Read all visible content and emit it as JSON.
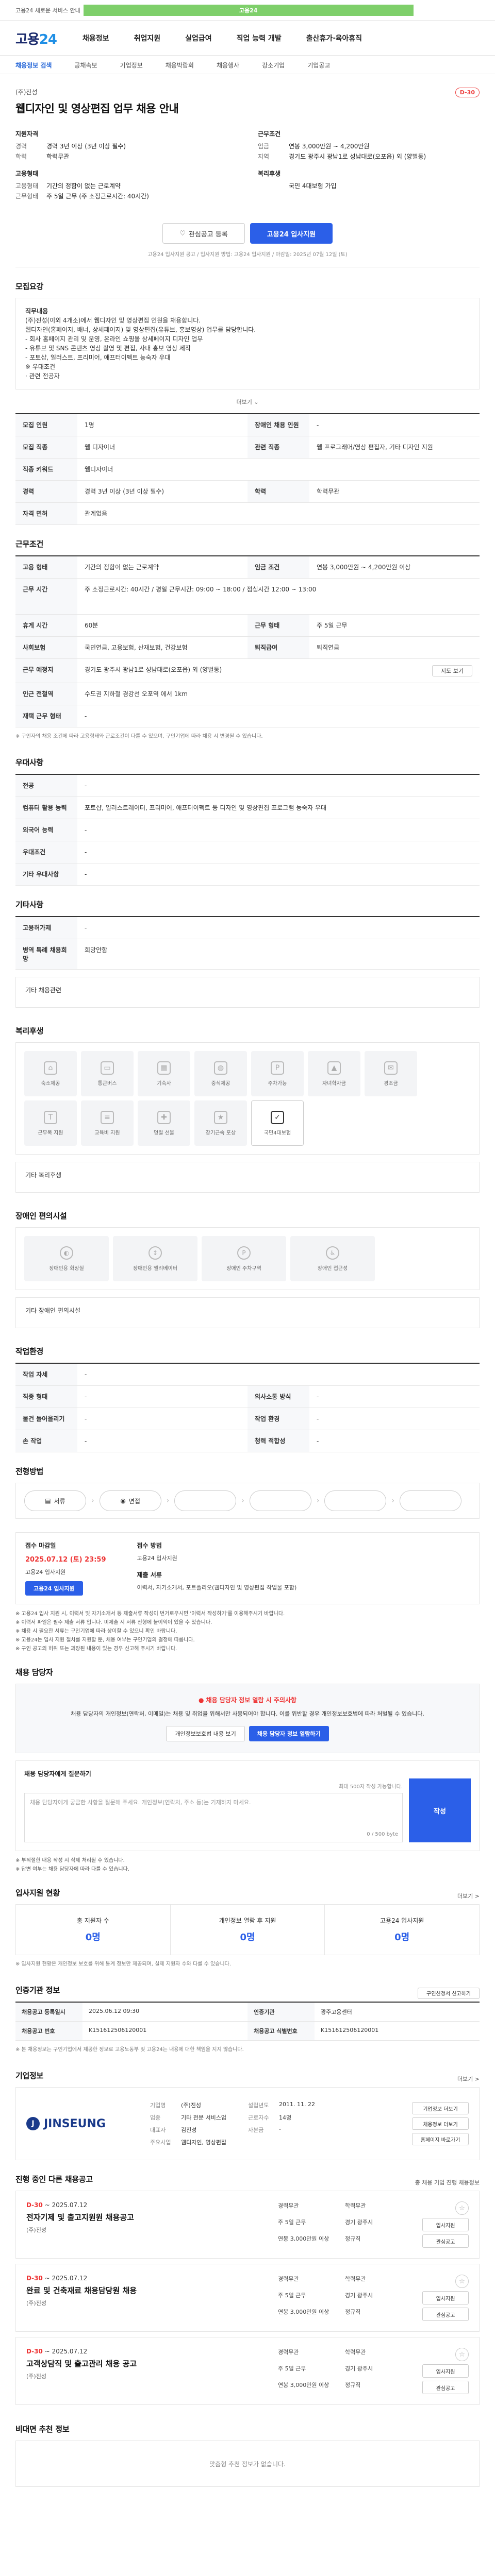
{
  "topbar": {
    "banner": "고용24",
    "notice": "고용24 새로운 서비스 안내"
  },
  "header": {
    "logo_main": "고용",
    "logo_num": "24",
    "gnb": [
      "채용정보",
      "취업지원",
      "실업급여",
      "직업 능력 개발",
      "출산휴가·육아휴직"
    ]
  },
  "subnav": [
    "채용정보 검색",
    "공채속보",
    "기업정보",
    "채용박람회",
    "채용행사",
    "강소기업",
    "기업공고"
  ],
  "job": {
    "company": "(주)진성",
    "title": "웹디자인 및 영상편집 업무 채용 안내",
    "dday": "D-30",
    "summary_left": [
      {
        "head": "지원자격",
        "rows": [
          {
            "k": "경력",
            "v": "경력 3년 이상 (3년 이상 필수)"
          },
          {
            "k": "학력",
            "v": "학력무관"
          }
        ]
      },
      {
        "head": "고용형태",
        "rows": [
          {
            "k": "고용형태",
            "v": "기간의 정함이 없는 근로계약"
          },
          {
            "k": "근무형태",
            "v": "주 5일 근무 (주 소정근로시간: 40시간)"
          }
        ]
      }
    ],
    "summary_right": [
      {
        "head": "근무조건",
        "rows": [
          {
            "k": "임금",
            "v": "연봉 3,000만원 ~ 4,200만원"
          },
          {
            "k": "지역",
            "v": "경기도 광주시 광남1로 성남대로(오포읍) 외 (양벌동)"
          }
        ]
      },
      {
        "head": "복리후생",
        "rows": [
          {
            "k": "",
            "v": "국민 4대보험 가입"
          }
        ]
      }
    ],
    "btn_scrap": "관심공고 등록",
    "btn_apply": "고용24 입사지원",
    "action_note": "고용24 입사지원 공고 / 입사지원 방법: 고용24 입사지원 / 마감일: 2025년 07월 12일 (토)"
  },
  "recruit": {
    "title": "모집요강",
    "desc_lines": [
      "직무내용",
      "(주)진성(이외 4개소)에서 웹디자인 및 영상편집 인원을 채용합니다.",
      "웹디자인(홈페이지, 배너, 상세페이지) 및 영상편집(유튜브, 홍보영상) 업무를 담당합니다.",
      "- 회사 홈페이지 관리 및 운영, 온라인 쇼핑몰 상세페이지 디자인 업무",
      "- 유튜브 및 SNS 콘텐츠 영상 촬영 및 편집, 사내 홍보 영상 제작",
      "- 포토샵, 일러스트, 프리미어, 애프터이펙트 능숙자 우대",
      "※ 우대조건",
      "· 관련 전공자"
    ],
    "expand": "더보기",
    "rows": [
      {
        "k": "모집 인원",
        "v": "1명",
        "k2": "장애인 채용 인원",
        "v2": "-"
      },
      {
        "k": "모집 직종",
        "v": "웹 디자이너",
        "k2": "관련 직종",
        "v2": "웹 프로그래머/영상 편집자, 기타 디자인 지원"
      },
      {
        "k": "직종 키워드",
        "v": "웹디자이너",
        "k2": "",
        "v2": ""
      },
      {
        "k": "경력",
        "v": "경력 3년 이상 (3년 이상 필수)",
        "k2": "학력",
        "v2": "학력무관"
      },
      {
        "k": "자격 면허",
        "v": "관계없음",
        "k2": "",
        "v2": ""
      }
    ]
  },
  "work": {
    "title": "근무조건",
    "rows": [
      {
        "k": "고용 형태",
        "v": "기간의 정함이 없는 근로계약",
        "k2": "임금 조건",
        "v2": "연봉 3,000만원 ~ 4,200만원 이상"
      },
      {
        "k": "근무 시간",
        "v": "주 소정근로시간: 40시간 / 평일 근무시간: 09:00 ~ 18:00 / 점심시간 12:00 ~ 13:00"
      },
      {
        "k": "휴게 시간",
        "v": "60분",
        "k2": "근무 형태",
        "v2": "주 5일 근무"
      },
      {
        "k": "사회보험",
        "v": "국민연금, 고용보험, 산재보험, 건강보험",
        "k2": "퇴직급여",
        "v2": "퇴직연금"
      },
      {
        "k": "근무 예정지",
        "v": "경기도 광주시 광남1로 성남대로(오포읍) 외 (양벌동)",
        "k2": "",
        "v2": "지도 보기"
      },
      {
        "k": "인근 전철역",
        "v": "수도권 지하철 경강선 오포역 에서 1km",
        "k2": "",
        "v2": ""
      },
      {
        "k": "재택 근무 형태",
        "v": "-",
        "k2": "",
        "v2": ""
      }
    ],
    "note": "※ 구인자의 채용 조건에 따라 고용형태와 근로조건이 다를 수 있으며, 구인기업에 따라 채용 시 변경될 수 있습니다."
  },
  "pref": {
    "title": "우대사항",
    "rows": [
      {
        "k": "전공",
        "v": "-"
      },
      {
        "k": "컴퓨터 활용 능력",
        "v": "포토샵, 일러스트레이터, 프리미어, 애프터이펙트 등 디자인 및 영상편집 프로그램 능숙자 우대"
      },
      {
        "k": "외국어 능력",
        "v": "-"
      },
      {
        "k": "우대조건",
        "v": "-"
      },
      {
        "k": "기타 우대사항",
        "v": "-"
      }
    ]
  },
  "etc": {
    "title": "기타사항",
    "rows": [
      {
        "k": "고용허가제",
        "v": "-"
      },
      {
        "k": "병역 특례 채용희망",
        "v": "희망안함"
      }
    ],
    "more": "기타 채용관련"
  },
  "welfare": {
    "title": "복리후생",
    "items": [
      {
        "label": "숙소제공",
        "on": false
      },
      {
        "label": "통근버스",
        "on": false
      },
      {
        "label": "기숙사",
        "on": false
      },
      {
        "label": "중식제공",
        "on": false
      },
      {
        "label": "주차가능",
        "on": false
      },
      {
        "label": "자녀학자금",
        "on": false
      },
      {
        "label": "경조금",
        "on": false
      },
      {
        "label": "근무복 지원",
        "on": false
      },
      {
        "label": "교육비 지원",
        "on": false
      },
      {
        "label": "명절 선물",
        "on": false
      },
      {
        "label": "장기근속 포상",
        "on": false
      },
      {
        "label": "국민4대보험",
        "on": true
      }
    ],
    "other": "기타 복리후생"
  },
  "disability": {
    "title": "장애인 편의시설",
    "items": [
      "장애인용 화장실",
      "장애인용 엘리베이터",
      "장애인 주차구역",
      "장애인 접근성"
    ],
    "other": "기타 장애인 편의시설"
  },
  "env": {
    "title": "작업환경",
    "rows": [
      {
        "k": "작업 자세",
        "v": "-",
        "k2": "",
        "v2": ""
      },
      {
        "k": "직종 형태",
        "v": "-",
        "k2": "의사소통 방식",
        "v2": "-"
      },
      {
        "k": "물건 들어올리기",
        "v": "-",
        "k2": "작업 환경",
        "v2": "-"
      },
      {
        "k": "손 작업",
        "v": "-",
        "k2": "청력 적합성",
        "v2": "-"
      }
    ]
  },
  "process": {
    "title": "전형방법",
    "steps": [
      "서류",
      "면접",
      "",
      "",
      "",
      ""
    ]
  },
  "apply": {
    "col1_label": "접수 마감일",
    "col1_date": "2025.07.12 (토) 23:59",
    "col1_sub": "고용24 입사지원",
    "btn": "고용24 입사지원",
    "col2_label": "접수 방법",
    "col2_txt": "고용24 입사지원",
    "col3_label": "제출 서류",
    "col3_txt": "이력서, 자기소개서, 포트폴리오(웹디자인 및 영상편집 작업물 포함)",
    "bullets": [
      "※ 고용24 입사 지원 시, 이력서 및 자기소개서 등 제출서류 작성이 번거로우시면 '이력서 작성하기'를 이용해주시기 바랍니다.",
      "※ 이력서 파일은 필수 제출 서류 입니다. 미제출 시 서류 전형에 불이익이 있을 수 있습니다.",
      "※ 채용 시 필요한 서류는 구인기업에 따라 상이할 수 있으니 확인 바랍니다.",
      "※ 고용24는 입사 지원 절차를 지원할 뿐, 채용 여부는 구인기업의 결정에 따릅니다.",
      "※ 구인 공고의 허위 또는 과장된 내용이 있는 경우 신고해 주시기 바랍니다."
    ]
  },
  "manager": {
    "title": "채용 담당자",
    "warn_title": "채용 담당자 정보 열람 시 주의사항",
    "warn_text": "채용 담당자의 개인정보(연락처, 이메일)는 채용 및 취업을 위해서만 사용되어야 합니다. 이를 위반할 경우 개인정보보호법에 따라 처벌될 수 있습니다.",
    "btn1": "개인정보보호법 내용 보기",
    "btn2": "채용 담당자 정보 열람하기",
    "ask_title": "채용 담당자에게 질문하기",
    "ask_placeholder": "채용 담당자에게 궁금한 사항을 질문해 주세요. 개인정보(연락처, 주소 등)는 기재하지 마세요.",
    "ask_limit": "최대 500자 작성 가능합니다.",
    "ask_count": "0 / 500 byte",
    "ask_btn": "작성",
    "ask_notes": [
      "※ 부적절한 내용 작성 시 삭제 처리될 수 있습니다.",
      "※ 답변 여부는 채용 담당자에 따라 다를 수 있습니다."
    ]
  },
  "applicants": {
    "title": "입사지원 현황",
    "more": "더보기 >",
    "stats": [
      {
        "l": "총 지원자 수",
        "n": "0명"
      },
      {
        "l": "개인정보 열람 후 지원",
        "n": "0명"
      },
      {
        "l": "고용24 입사지원",
        "n": "0명"
      }
    ],
    "note": "※ 입사지원 현황은 개인정보 보호를 위해 통계 정보만 제공되며, 실제 지원자 수와 다를 수 있습니다."
  },
  "notice_info": {
    "title": "인증기관 정보",
    "btn": "구인신청서 신고하기",
    "rows": [
      {
        "k": "채용공고 등록일시",
        "v": "2025.06.12 09:30",
        "k2": "인증기관",
        "v2": "광주고용센터"
      },
      {
        "k": "채용공고 번호",
        "v": "K151612506120001",
        "k2": "채용공고 식별번호",
        "v2": "K151612506120001"
      }
    ],
    "note": "※ 본 채용정보는 구인기업에서 제공한 정보로 고용노동부 및 고용24는 내용에 대한 책임을 지지 않습니다."
  },
  "corp": {
    "title": "기업정보",
    "more": "더보기 >",
    "logo": "JINSEUNG",
    "info": [
      {
        "k": "기업명",
        "v": "(주)진성"
      },
      {
        "k": "설립년도",
        "v": "2011. 11. 22"
      },
      {
        "k": "업종",
        "v": "기타 전문 서비스업"
      },
      {
        "k": "근로자수",
        "v": "14명"
      },
      {
        "k": "대표자",
        "v": "김진성"
      },
      {
        "k": "자본금",
        "v": "-"
      },
      {
        "k": "주요사업",
        "v": "웹디자인, 영상편집"
      },
      {
        "k": "",
        "v": ""
      }
    ],
    "btns": [
      "기업정보 더보기",
      "채용정보 더보기",
      "홈페이지 바로가기"
    ]
  },
  "others": {
    "title": "진행 중인 다른 채용공고",
    "note": "총 채용 기업 진행 채용정보",
    "jobs": [
      {
        "dday": "D-30",
        "date": "~ 2025.07.12",
        "title": "전자기제 및 출고지원원 채용공고",
        "co": "(주)진성",
        "meta": [
          "경력무관",
          "학력무관",
          "주 5일 근무",
          "경기 광주시",
          "연봉 3,000만원 이상",
          "정규직"
        ],
        "btns": [
          "입사지원",
          "관심공고"
        ]
      },
      {
        "dday": "D-30",
        "date": "~ 2025.07.12",
        "title": "완료 및 건축재료 채용담당원 채용",
        "co": "(주)진성",
        "meta": [
          "경력무관",
          "학력무관",
          "주 5일 근무",
          "경기 광주시",
          "연봉 3,000만원 이상",
          "정규직"
        ],
        "btns": [
          "입사지원",
          "관심공고"
        ]
      },
      {
        "dday": "D-30",
        "date": "~ 2025.07.12",
        "title": "고객상담직 및 출고관리 채용 공고",
        "co": "(주)진성",
        "meta": [
          "경력무관",
          "학력무관",
          "주 5일 근무",
          "경기 광주시",
          "연봉 3,000만원 이상",
          "정규직"
        ],
        "btns": [
          "입사지원",
          "관심공고"
        ]
      }
    ]
  },
  "recommend": {
    "title": "비대면 추천 정보",
    "empty": "맞춤형 추천 정보가 없습니다."
  }
}
